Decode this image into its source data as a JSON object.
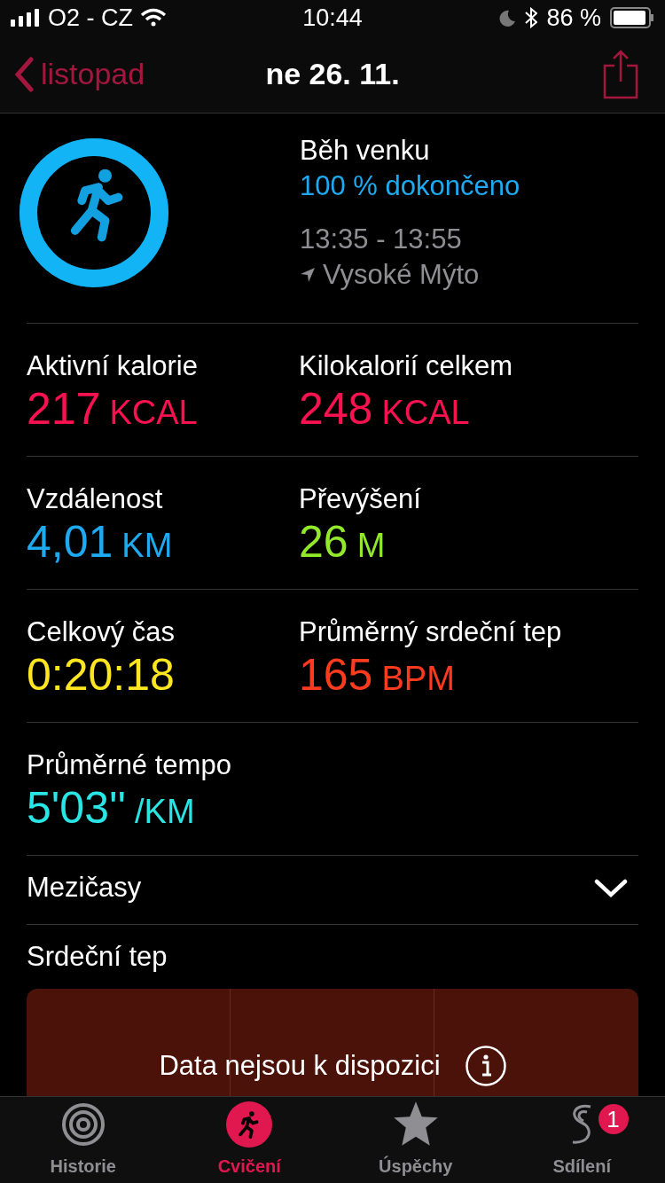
{
  "status_bar": {
    "carrier": "O2 - CZ",
    "time": "10:44",
    "battery": "86 %"
  },
  "nav": {
    "back": "listopad",
    "title": "ne 26. 11."
  },
  "workout": {
    "name": "Běh venku",
    "progress": "100 % dokončeno",
    "level": 1,
    "time_range": "13:35 - 13:55",
    "location": "Vysoké Mýto"
  },
  "metric_rows": [
    [
      {
        "label": "Aktivní kalorie",
        "value": "217",
        "unit": "KCAL",
        "color": "#fa114f"
      },
      {
        "label": "Kilokalorií celkem",
        "value": "248",
        "unit": "KCAL",
        "color": "#fa114f"
      }
    ],
    [
      {
        "label": "Vzdálenost",
        "value": "4,01",
        "unit": "KM",
        "color": "#1eaaf1"
      },
      {
        "label": "Převýšení",
        "value": "26",
        "unit": "M",
        "color": "#92e82a"
      }
    ],
    [
      {
        "label": "Celkový čas",
        "value": "0:20:18",
        "color": "#ffe620"
      },
      {
        "label": "Průměrný srdeční tep",
        "value": "165",
        "unit": "BPM",
        "color": "#ff3b1f"
      }
    ],
    [
      {
        "label": "Průměrné tempo",
        "value": "5'03''",
        "unit": "/KM",
        "color": "#2ae5e5"
      }
    ]
  ],
  "splits": {
    "label": "Mezičasy",
    "expanded": false
  },
  "heart_rate": {
    "label": "Srdeční tep",
    "message": "Data nejsou k dispozici"
  },
  "tabs": [
    {
      "label": "Historie",
      "selected": false,
      "kind": "history"
    },
    {
      "label": "Cvičení",
      "selected": true,
      "kind": "workout"
    },
    {
      "label": "Úspěchy",
      "selected": false,
      "kind": "awards"
    },
    {
      "label": "Sdílení",
      "selected": false,
      "kind": "sharing",
      "badge": "1"
    }
  ]
}
